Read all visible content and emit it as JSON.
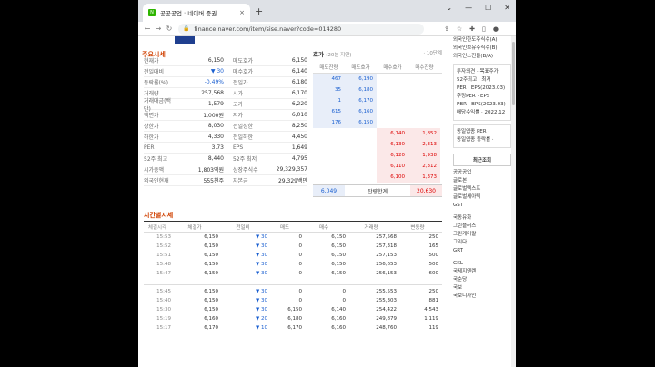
{
  "browser": {
    "tab_title": "공공공업 : 네이버 증권",
    "url": "finance.naver.com/item/sise.naver?code=014280"
  },
  "section1": {
    "title": "주요시세",
    "left": [
      [
        "현재가",
        "6,150"
      ],
      [
        "전일대비",
        "▼ 30"
      ],
      [
        "등락률(%)",
        "-0.49%"
      ],
      [
        "거래량",
        "257,568"
      ],
      [
        "거래대금(백만)",
        "1,579"
      ],
      [
        "액면가",
        "1,000원"
      ],
      [
        "상한가",
        "8,030"
      ],
      [
        "하한가",
        "4,330"
      ],
      [
        "PER",
        "3.73"
      ],
      [
        "52주 최고",
        "8,440"
      ],
      [
        "시가총액",
        "1,803억원"
      ],
      [
        "외국인현재",
        "555천주"
      ]
    ],
    "right": [
      [
        "매도호가",
        "6,150"
      ],
      [
        "매수호가",
        "6,140"
      ],
      [
        "전일가",
        "6,180"
      ],
      [
        "시가",
        "6,170"
      ],
      [
        "고가",
        "6,220"
      ],
      [
        "저가",
        "6,010"
      ],
      [
        "전일상한",
        "8,250"
      ],
      [
        "전일하한",
        "4,450"
      ],
      [
        "EPS",
        "1,649"
      ],
      [
        "52주 최저",
        "4,795"
      ],
      [
        "상장주식수",
        "29,329,357"
      ],
      [
        "자본금",
        "29,329백만"
      ]
    ]
  },
  "hoga": {
    "title": "호가",
    "sub": "(20분 지연)",
    "unit": "· 10단계",
    "headers": [
      "매도잔량",
      "매도호가",
      "매수호가",
      "매수잔량"
    ],
    "asks": [
      [
        "467",
        "6,190"
      ],
      [
        "35",
        "6,180"
      ],
      [
        "1",
        "6,170"
      ],
      [
        "615",
        "6,160"
      ],
      [
        "176",
        "6,150"
      ]
    ],
    "bids": [
      [
        "6,140",
        "1,852"
      ],
      [
        "6,130",
        "2,313"
      ],
      [
        "6,120",
        "1,938"
      ],
      [
        "6,110",
        "2,312"
      ],
      [
        "6,100",
        "1,373"
      ]
    ],
    "total_ask": "6,049",
    "total_label": "잔량합계",
    "total_bid": "20,630"
  },
  "section2": {
    "title": "시간별시세",
    "headers": [
      "체결시각",
      "체결가",
      "전일비",
      "매도",
      "매수",
      "거래량",
      "변동량"
    ],
    "group1": [
      [
        "15:53",
        "6,150",
        "▼ 30",
        "0",
        "6,150",
        "257,568",
        "250"
      ],
      [
        "15:52",
        "6,150",
        "▼ 30",
        "0",
        "6,150",
        "257,318",
        "165"
      ],
      [
        "15:51",
        "6,150",
        "▼ 30",
        "0",
        "6,150",
        "257,153",
        "500"
      ],
      [
        "15:48",
        "6,150",
        "▼ 30",
        "0",
        "6,150",
        "256,653",
        "500"
      ],
      [
        "15:47",
        "6,150",
        "▼ 30",
        "0",
        "6,150",
        "256,153",
        "600"
      ]
    ],
    "group2": [
      [
        "15:45",
        "6,150",
        "▼ 30",
        "0",
        "0",
        "255,553",
        "250"
      ],
      [
        "15:40",
        "6,150",
        "▼ 30",
        "0",
        "0",
        "255,303",
        "881"
      ],
      [
        "15:30",
        "6,150",
        "▼ 30",
        "6,150",
        "6,140",
        "254,422",
        "4,543"
      ],
      [
        "15:19",
        "6,160",
        "▼ 20",
        "6,180",
        "6,160",
        "249,879",
        "1,119"
      ],
      [
        "15:17",
        "6,170",
        "▼ 10",
        "6,170",
        "6,160",
        "248,760",
        "119"
      ]
    ]
  },
  "sidebar": {
    "top": [
      "외국인한도주식수(A)",
      "외국인보유주식수(B)",
      "외국인소진율(B/A)"
    ],
    "invest": [
      "투자의견 · 목표주가",
      "52주최고 · 최저",
      "PER · EPS(2023.03)",
      "추정PER · EPS",
      "PBR · BPS(2023.03)",
      "배당수익률 · 2022.12"
    ],
    "ind": [
      "동일업종 PER ·",
      "동일업종 등락률 ·"
    ],
    "tab": "최근조회",
    "list1": [
      "공공공업",
      "글로본",
      "글로벌텍스프",
      "글로벌세아텍",
      "GST"
    ],
    "list2": [
      "국동유화",
      "그린플러스",
      "그린케미칼",
      "그리다",
      "GRT"
    ],
    "list3": [
      "GKL",
      "국제지엔렌",
      "국순당",
      "국보",
      "국보디자인"
    ]
  }
}
